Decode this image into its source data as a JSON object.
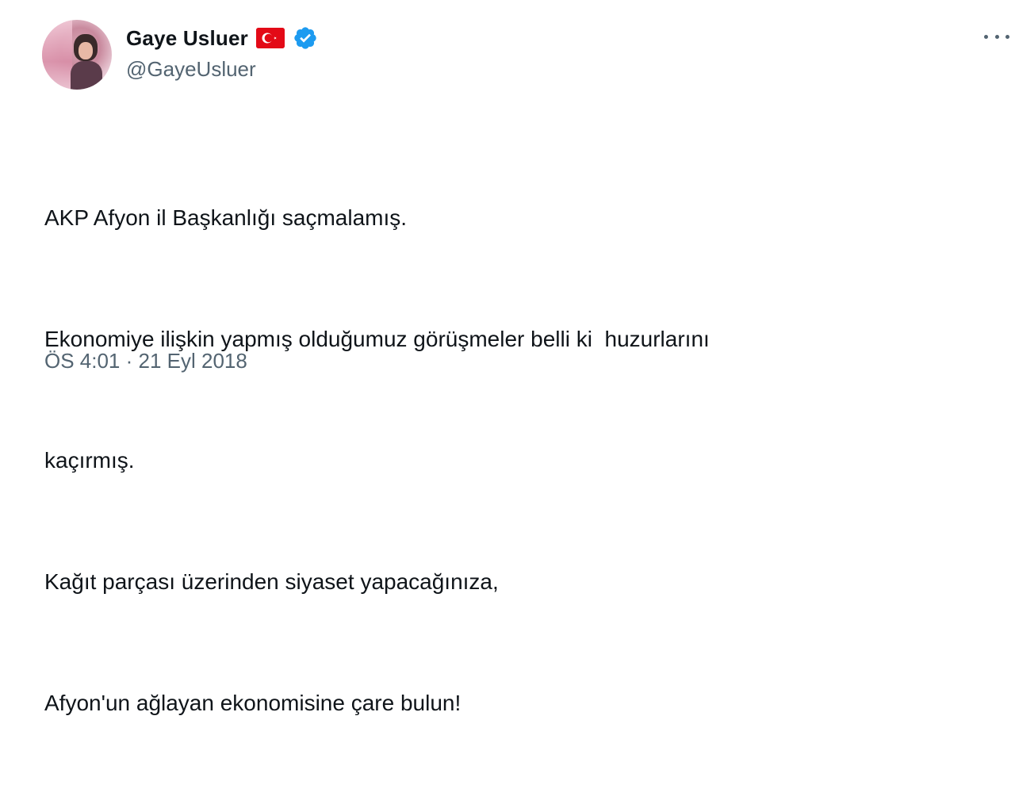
{
  "author": {
    "display_name": "Gaye Usluer",
    "handle": "@GayeUsluer",
    "flag_icon": "turkey-flag-icon",
    "verified_icon": "verified-badge-icon",
    "flag_color": "#e30a17",
    "verified_color": "#1d9bf0"
  },
  "tweet": {
    "lines": [
      "AKP Afyon il Başkanlığı saçmalamış.",
      "Ekonomiye ilişkin yapmış olduğumuz görüşmeler belli ki  huzurlarını",
      "kaçırmış.",
      "Kağıt parçası üzerinden siyaset yapacağınıza,",
      "Afyon'un ağlayan ekonomisine çare bulun!"
    ],
    "timestamp": "ÖS 4:01 · 21 Eyl 2018"
  },
  "menu": {
    "icon": "more-options-icon"
  },
  "colors": {
    "text": "#0f1419",
    "secondary_text": "#536471",
    "background": "#ffffff"
  }
}
